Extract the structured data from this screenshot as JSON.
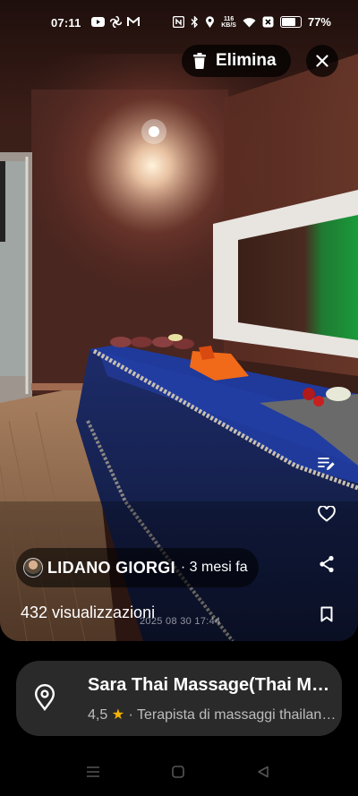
{
  "status_bar": {
    "time": "07:11",
    "net_speed_value": "116",
    "net_speed_unit": "KB/S",
    "battery_percent": "77%",
    "battery_level": 0.77
  },
  "toolbar": {
    "delete_label": "Elimina"
  },
  "post": {
    "author_name": "LIDANO GIORGI",
    "time_ago": "· 3 mesi fa",
    "views": "432 visualizzazioni",
    "photo_timestamp": "2025 08 30 17:44"
  },
  "place": {
    "name": "Sara Thai Massage(Thai Massage...",
    "rating": "4,5",
    "category": "· Terapista di massaggi thailandesi"
  },
  "colors": {
    "wall": "#4a2620",
    "bed_cover": "#1c2f7a",
    "card_bg": "#2a2a2a",
    "star": "#f5b400"
  },
  "icons": {
    "delete": "trash-icon",
    "close": "close-icon",
    "edit": "edit-note-icon",
    "like": "heart-icon",
    "share": "share-icon",
    "save": "bookmark-icon",
    "location": "location-pin-icon"
  }
}
